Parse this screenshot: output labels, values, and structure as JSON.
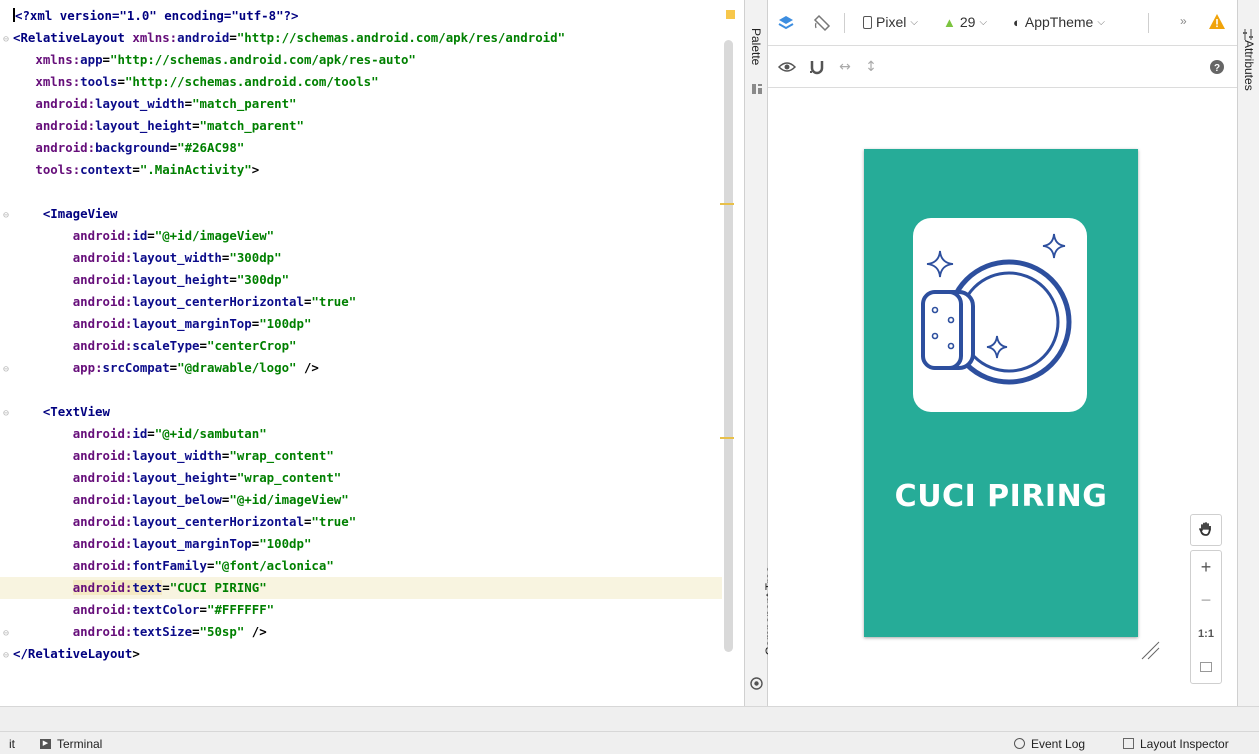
{
  "editor": {
    "lines": [
      {
        "gutter": "",
        "pi": "<?xml version=\"1.0\" encoding=\"utf-8\"?>"
      },
      {
        "gutter": "⊖",
        "tag": "<RelativeLayout",
        "ns": "xmlns:",
        "attr": "android",
        "val": "\"http://schemas.android.com/apk/res/android\""
      },
      {
        "gutter": "",
        "ns": "xmlns:",
        "attr": "app",
        "val": "\"http://schemas.android.com/apk/res-auto\""
      },
      {
        "gutter": "",
        "ns": "xmlns:",
        "attr": "tools",
        "val": "\"http://schemas.android.com/tools\""
      },
      {
        "gutter": "",
        "ns": "android:",
        "attr": "layout_width",
        "val": "\"match_parent\""
      },
      {
        "gutter": "",
        "ns": "android:",
        "attr": "layout_height",
        "val": "\"match_parent\""
      },
      {
        "gutter": "",
        "ns": "android:",
        "attr": "background",
        "val": "\"#26AC98\""
      },
      {
        "gutter": "",
        "ns": "tools:",
        "attr": "context",
        "val": "\".MainActivity\"",
        "end": ">"
      },
      {
        "gutter": ""
      },
      {
        "gutter": "⊖",
        "tag": "<ImageView",
        "underline": true
      },
      {
        "gutter": "",
        "ns": "android:",
        "attr": "id",
        "val": "\"@+id/imageView\""
      },
      {
        "gutter": "",
        "ns": "android:",
        "attr": "layout_width",
        "val": "\"300dp\""
      },
      {
        "gutter": "",
        "ns": "android:",
        "attr": "layout_height",
        "val": "\"300dp\""
      },
      {
        "gutter": "",
        "ns": "android:",
        "attr": "layout_centerHorizontal",
        "val": "\"true\""
      },
      {
        "gutter": "",
        "ns": "android:",
        "attr": "layout_marginTop",
        "val": "\"100dp\""
      },
      {
        "gutter": "",
        "ns": "android:",
        "attr": "scaleType",
        "val": "\"centerCrop\""
      },
      {
        "gutter": "⊖",
        "ns": "app:",
        "attr": "srcCompat",
        "val": "\"@drawable/logo\"",
        "end": " />"
      },
      {
        "gutter": ""
      },
      {
        "gutter": "⊖",
        "tag": "<TextView"
      },
      {
        "gutter": "",
        "ns": "android:",
        "attr": "id",
        "val": "\"@+id/sambutan\""
      },
      {
        "gutter": "",
        "ns": "android:",
        "attr": "layout_width",
        "val": "\"wrap_content\""
      },
      {
        "gutter": "",
        "ns": "android:",
        "attr": "layout_height",
        "val": "\"wrap_content\""
      },
      {
        "gutter": "",
        "ns": "android:",
        "attr": "layout_below",
        "val": "\"@+id/imageView\""
      },
      {
        "gutter": "",
        "ns": "android:",
        "attr": "layout_centerHorizontal",
        "val": "\"true\""
      },
      {
        "gutter": "",
        "ns": "android:",
        "attr": "layout_marginTop",
        "val": "\"100dp\""
      },
      {
        "gutter": "",
        "ns": "android:",
        "attr": "fontFamily",
        "val": "\"@font/aclonica\""
      },
      {
        "gutter": "",
        "ns": "android:",
        "attr": "text",
        "val": "\"CUCI PIRING\"",
        "highlight": true
      },
      {
        "gutter": "",
        "ns": "android:",
        "attr": "textColor",
        "val": "\"#FFFFFF\""
      },
      {
        "gutter": "⊖",
        "ns": "android:",
        "attr": "textSize",
        "val": "\"50sp\"",
        "end": " />"
      },
      {
        "gutter": "⊖",
        "tag": "</RelativeLayout",
        "end": ">"
      }
    ]
  },
  "sidebar_left": {
    "palette_label": "Palette",
    "component_tree_label": "Component Tree"
  },
  "sidebar_right": {
    "attributes_label": "Attributes"
  },
  "design_toolbar": {
    "device": "Pixel",
    "api_level": "29",
    "theme": "AppTheme",
    "more": "»"
  },
  "preview": {
    "background_color": "#26AC98",
    "text": "CUCI PIRING"
  },
  "zoom_controls": {
    "plus": "+",
    "minus": "−",
    "one_to_one": "1:1"
  },
  "status_bar": {
    "partial_left": "it",
    "terminal": "Terminal",
    "event_log": "Event Log",
    "layout_inspector": "Layout Inspector"
  }
}
